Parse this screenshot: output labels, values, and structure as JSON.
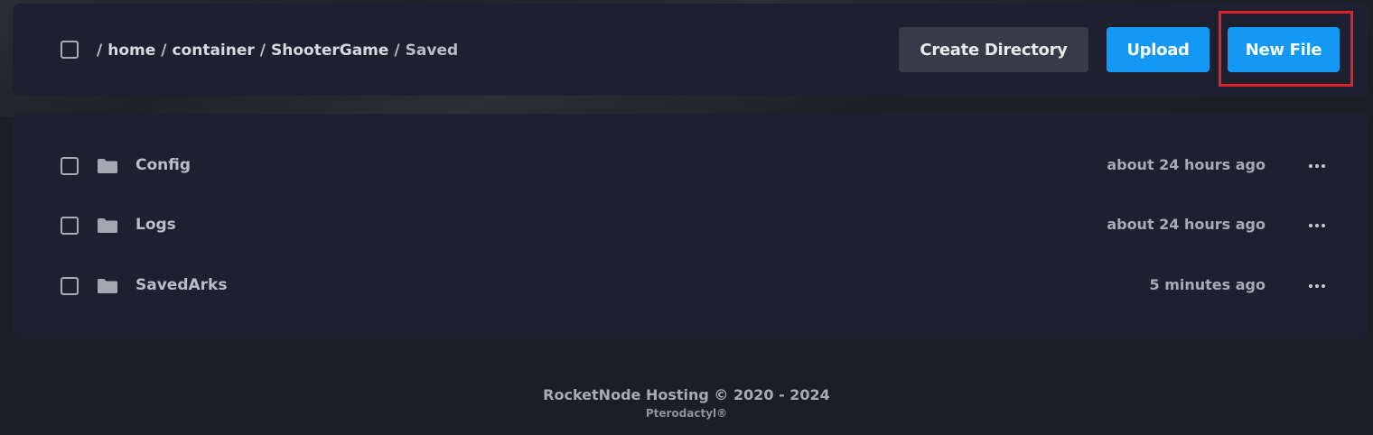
{
  "breadcrumb": {
    "leading_sep": "/",
    "items": [
      {
        "label": "home"
      },
      {
        "label": "container"
      },
      {
        "label": "ShooterGame"
      },
      {
        "label": "Saved"
      }
    ],
    "sep": "/"
  },
  "toolbar": {
    "create_directory_label": "Create Directory",
    "upload_label": "Upload",
    "new_file_label": "New File"
  },
  "files": [
    {
      "name": "Config",
      "modified": "about 24 hours ago",
      "icon": "folder-icon"
    },
    {
      "name": "Logs",
      "modified": "about 24 hours ago",
      "icon": "folder-icon"
    },
    {
      "name": "SavedArks",
      "modified": "5 minutes ago",
      "icon": "folder-icon"
    }
  ],
  "footer": {
    "main": "RocketNode Hosting © 2020 - 2024",
    "sub": "Pterodactyl®"
  },
  "colors": {
    "accent_blue": "#1398f5",
    "highlight_red": "#e0202a",
    "panel_bg": "#1e2030"
  }
}
